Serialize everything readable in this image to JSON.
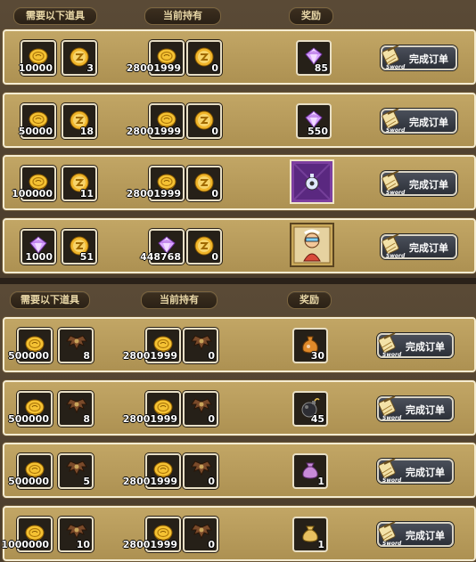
{
  "headers": {
    "need": "需要以下道具",
    "have": "当前持有",
    "reward": "奖励"
  },
  "button": {
    "label": "完成订单",
    "sub": "Sword"
  },
  "panels": [
    {
      "rows": [
        {
          "need": [
            {
              "icon": "gold-coin-icon",
              "qty": "10000"
            },
            {
              "icon": "coupon-coin-icon",
              "qty": "3"
            }
          ],
          "have": [
            {
              "icon": "gold-coin-icon",
              "qty": "28001999"
            },
            {
              "icon": "coupon-coin-icon",
              "qty": "0"
            }
          ],
          "reward": {
            "icon": "purple-gem-icon",
            "qty": "85"
          }
        },
        {
          "need": [
            {
              "icon": "gold-coin-icon",
              "qty": "50000"
            },
            {
              "icon": "coupon-coin-icon",
              "qty": "18"
            }
          ],
          "have": [
            {
              "icon": "gold-coin-icon",
              "qty": "28001999"
            },
            {
              "icon": "coupon-coin-icon",
              "qty": "0"
            }
          ],
          "reward": {
            "icon": "purple-gem-icon",
            "qty": "550"
          }
        },
        {
          "need": [
            {
              "icon": "gold-coin-icon",
              "qty": "100000"
            },
            {
              "icon": "coupon-coin-icon",
              "qty": "11"
            }
          ],
          "have": [
            {
              "icon": "gold-coin-icon",
              "qty": "28001999"
            },
            {
              "icon": "coupon-coin-icon",
              "qty": "0"
            }
          ],
          "reward": {
            "icon": "purple-card-icon",
            "qty": ""
          }
        },
        {
          "need": [
            {
              "icon": "purple-gem-icon",
              "qty": "1000"
            },
            {
              "icon": "coupon-coin-icon",
              "qty": "51"
            }
          ],
          "have": [
            {
              "icon": "purple-gem-icon",
              "qty": "448768"
            },
            {
              "icon": "coupon-coin-icon",
              "qty": "0"
            }
          ],
          "reward": {
            "icon": "character-card-icon",
            "qty": ""
          }
        }
      ]
    },
    {
      "rows": [
        {
          "need": [
            {
              "icon": "gold-coin-icon",
              "qty": "500000"
            },
            {
              "icon": "bat-wing-icon",
              "qty": "8"
            }
          ],
          "have": [
            {
              "icon": "gold-coin-icon",
              "qty": "28001999"
            },
            {
              "icon": "bat-wing-icon",
              "qty": "0"
            }
          ],
          "reward": {
            "icon": "potion-bag-icon",
            "qty": "30"
          }
        },
        {
          "need": [
            {
              "icon": "gold-coin-icon",
              "qty": "500000"
            },
            {
              "icon": "bat-wing-icon",
              "qty": "8"
            }
          ],
          "have": [
            {
              "icon": "gold-coin-icon",
              "qty": "28001999"
            },
            {
              "icon": "bat-wing-icon",
              "qty": "0"
            }
          ],
          "reward": {
            "icon": "bomb-icon",
            "qty": "45"
          }
        },
        {
          "need": [
            {
              "icon": "gold-coin-icon",
              "qty": "500000"
            },
            {
              "icon": "bat-wing-icon",
              "qty": "5"
            }
          ],
          "have": [
            {
              "icon": "gold-coin-icon",
              "qty": "28001999"
            },
            {
              "icon": "bat-wing-icon",
              "qty": "0"
            }
          ],
          "reward": {
            "icon": "purple-pouch-icon",
            "qty": "1"
          }
        },
        {
          "need": [
            {
              "icon": "gold-coin-icon",
              "qty": "1000000"
            },
            {
              "icon": "bat-wing-icon",
              "qty": "10"
            }
          ],
          "have": [
            {
              "icon": "gold-coin-icon",
              "qty": "28001999"
            },
            {
              "icon": "bat-wing-icon",
              "qty": "0"
            }
          ],
          "reward": {
            "icon": "gold-pouch-icon",
            "qty": "1"
          }
        }
      ]
    }
  ]
}
